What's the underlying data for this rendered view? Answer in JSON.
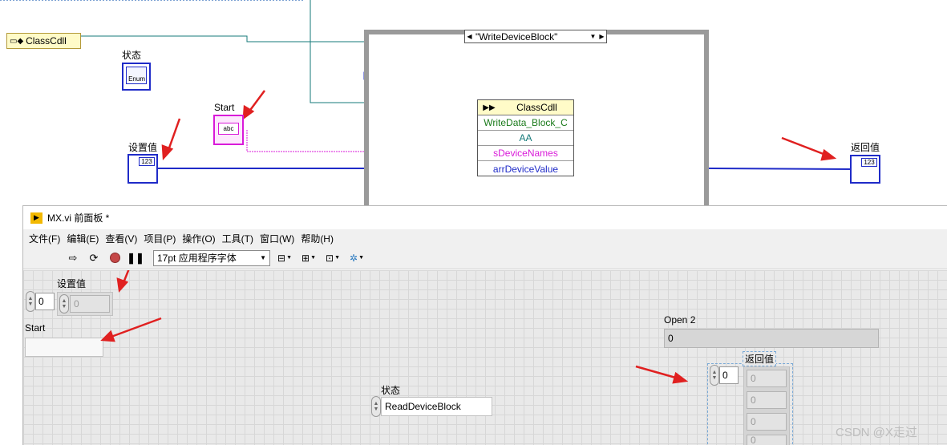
{
  "block_diagram": {
    "class_ref_label": "ClassCdll",
    "state_label": "状态",
    "state_enum_text": "Enum",
    "start_label": "Start",
    "start_term_text": "abc",
    "setvalue_label": "设置值",
    "setvalue_term_text": "123",
    "return_label": "返回值",
    "return_term_text": "123",
    "case_selector_value": "\"WriteDeviceBlock\"",
    "node": {
      "title": "ClassCdll",
      "method": "WriteData_Block_C",
      "rows": [
        "AA",
        "sDeviceNames",
        "arrDeviceValue"
      ]
    },
    "colors": {
      "int_wire": "#1f2bc8",
      "string_wire": "#d91ad9",
      "ref_wire": "#157a7a",
      "arrow": "#e02020"
    }
  },
  "front_panel": {
    "window_title": "MX.vi 前面板 *",
    "menu": [
      "文件(F)",
      "编辑(E)",
      "查看(V)",
      "项目(P)",
      "操作(O)",
      "工具(T)",
      "窗口(W)",
      "帮助(H)"
    ],
    "toolbar": {
      "icons": [
        "run-arrow-icon",
        "run-continuous-icon",
        "abort-icon",
        "pause-icon"
      ],
      "font_select": "17pt 应用程序字体"
    },
    "setvalue": {
      "label": "设置值",
      "index": "0",
      "value": "0"
    },
    "start": {
      "label": "Start",
      "value": ""
    },
    "open2": {
      "label": "Open 2",
      "value": "0"
    },
    "state": {
      "label": "状态",
      "value": "ReadDeviceBlock"
    },
    "return": {
      "label": "返回值",
      "index": "0",
      "values": [
        "0",
        "0",
        "0",
        "0"
      ]
    }
  },
  "watermark": "CSDN @X走过"
}
